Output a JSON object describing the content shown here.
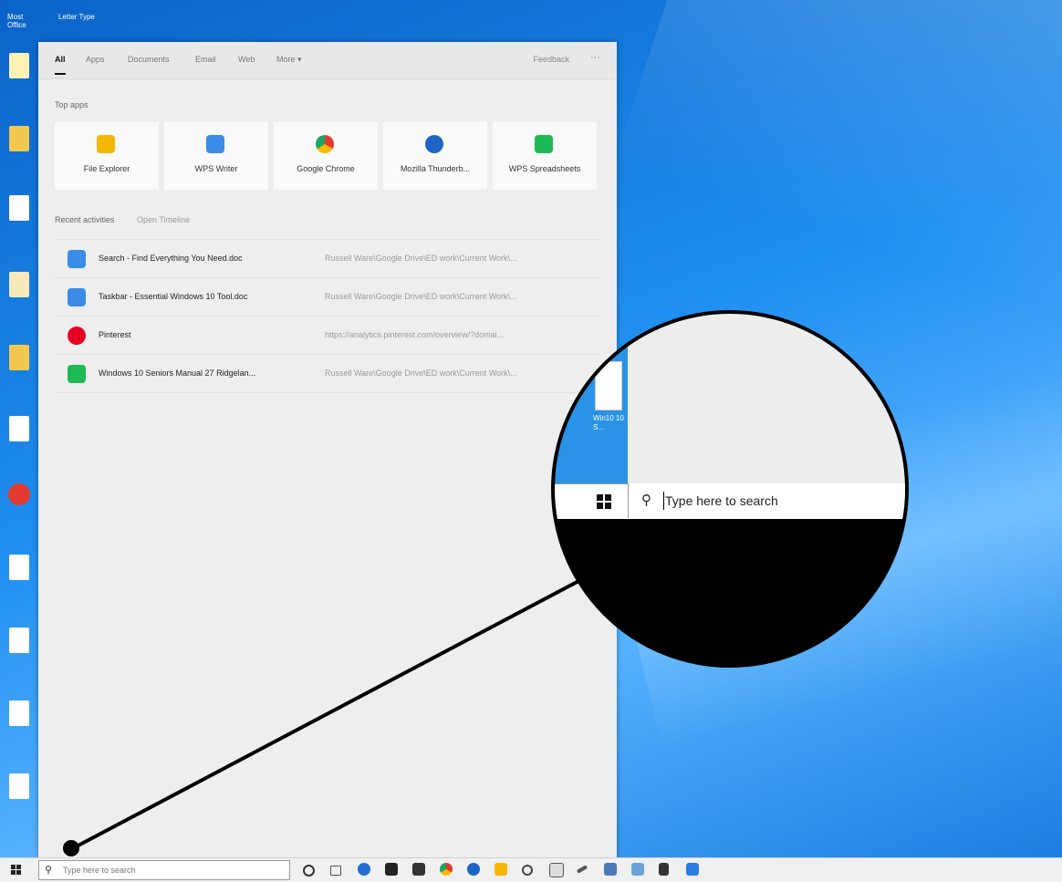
{
  "desktop": {
    "top_labels": [
      "Most",
      "Office"
    ],
    "top_labels2": "Letter Type"
  },
  "search_panel": {
    "tabs": [
      "All",
      "Apps",
      "Documents",
      "Email",
      "Web",
      "More ▾"
    ],
    "feedback": "Feedback",
    "more_dots": "···",
    "top_apps_label": "Top apps",
    "top_apps": [
      {
        "name": "File Explorer",
        "color": "#f5b800",
        "icon": "folder-icon"
      },
      {
        "name": "WPS Writer",
        "color": "#3b8be8",
        "icon": "wps-writer-icon"
      },
      {
        "name": "Google Chrome",
        "color": "#e23a2e",
        "icon": "chrome-icon"
      },
      {
        "name": "Mozilla Thunderb...",
        "color": "#1f63c6",
        "icon": "thunderbird-icon"
      },
      {
        "name": "WPS Spreadsheets",
        "color": "#1db954",
        "icon": "wps-spreadsheets-icon"
      }
    ],
    "recent_label": "Recent activities",
    "open_timeline": "Open Timeline",
    "recent": [
      {
        "name": "Search - Find Everything You Need.doc",
        "path": "Russell Ware\\Google Drive\\ED work\\Current Work\\...",
        "color": "#3b8be8",
        "icon": "wps-writer-icon"
      },
      {
        "name": "Taskbar - Essential Windows 10 Tool.doc",
        "path": "Russell Ware\\Google Drive\\ED work\\Current Work\\...",
        "color": "#3b8be8",
        "icon": "wps-writer-icon"
      },
      {
        "name": "Pinterest",
        "path": "https://analytics.pinterest.com/overview/?domai...",
        "color": "#e60023",
        "icon": "pinterest-icon"
      },
      {
        "name": "Windows 10 Seniors Manual 27 Ridgelan...",
        "path": "Russell Ware\\Google Drive\\ED work\\Current Work\\...",
        "color": "#1db954",
        "icon": "wps-spreadsheets-icon"
      }
    ]
  },
  "taskbar": {
    "search_placeholder": "Type here to search",
    "icons": [
      "cortana-icon",
      "task-view-icon",
      "edge-icon",
      "store-icon",
      "mail-icon",
      "chrome-icon",
      "thunderbird-icon",
      "file-explorer-icon",
      "settings-icon",
      "calendar-icon",
      "pen-icon",
      "tools-icon",
      "mail2-icon",
      "calculator-icon",
      "app-icon"
    ]
  },
  "magnifier": {
    "search_text": "Type here to search",
    "doc_label": "Win10 10 S..."
  }
}
